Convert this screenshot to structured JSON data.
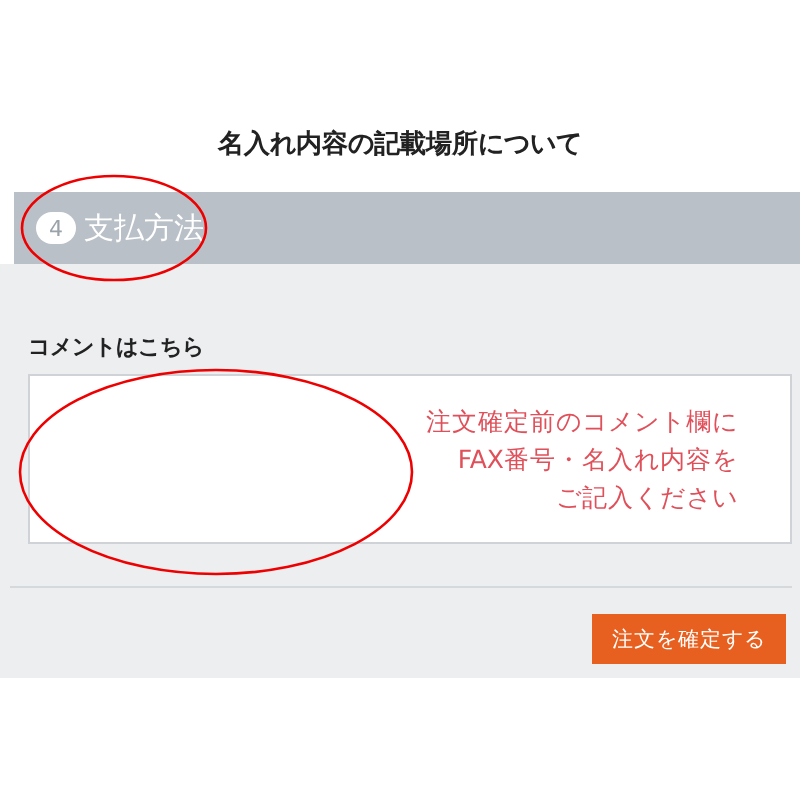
{
  "title": "名入れ内容の記載場所について",
  "step": {
    "number": "4",
    "label": "支払方法"
  },
  "comment": {
    "label": "コメントはこちら"
  },
  "note_lines": [
    "注文確定前のコメント欄に",
    "FAX番号・名入れ内容を",
    "ご記入ください"
  ],
  "buttons": [
    {
      "label": "注文を確定する"
    }
  ]
}
